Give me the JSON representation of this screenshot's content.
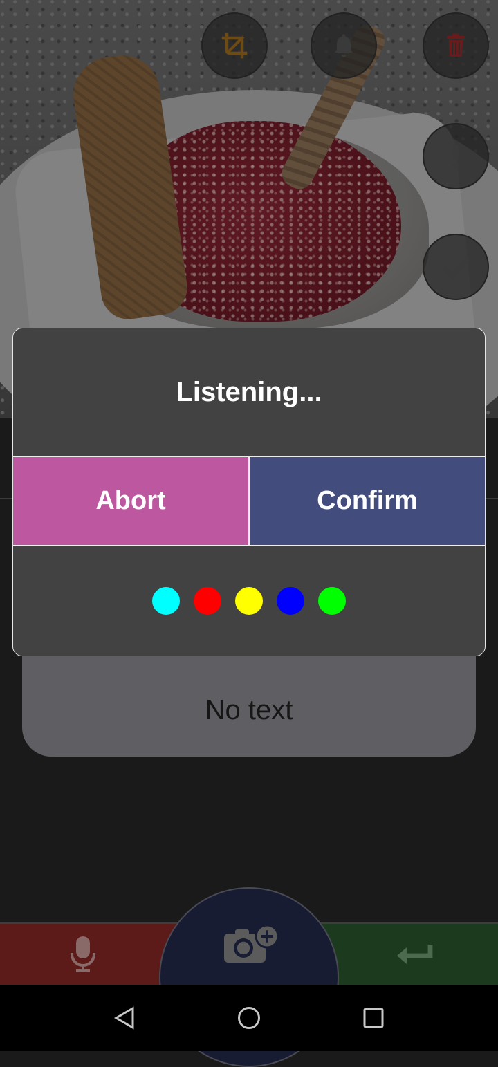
{
  "dialog": {
    "title": "Listening...",
    "abort_label": "Abort",
    "confirm_label": "Confirm",
    "indicator_colors": [
      "#00ffff",
      "#ff0000",
      "#ffff00",
      "#0000ff",
      "#00ff00"
    ]
  },
  "recognized_text": {
    "value": "No text"
  },
  "toolbar_icons": {
    "crop": "crop-icon",
    "bell": "bell-icon",
    "delete": "trash-icon",
    "alert": "exclamation-icon",
    "confirm": "checkmark-icon"
  },
  "bottom_bar": {
    "mic": "microphone-icon",
    "camera": "camera-add-icon",
    "enter": "enter-return-icon"
  },
  "colors": {
    "dialog_background": "#424242",
    "abort": "#bd57a0",
    "confirm": "#434d7d",
    "mic_bar": "#5c1a18",
    "enter_bar": "#1c3a1e",
    "camera_fab": "#171c33"
  }
}
